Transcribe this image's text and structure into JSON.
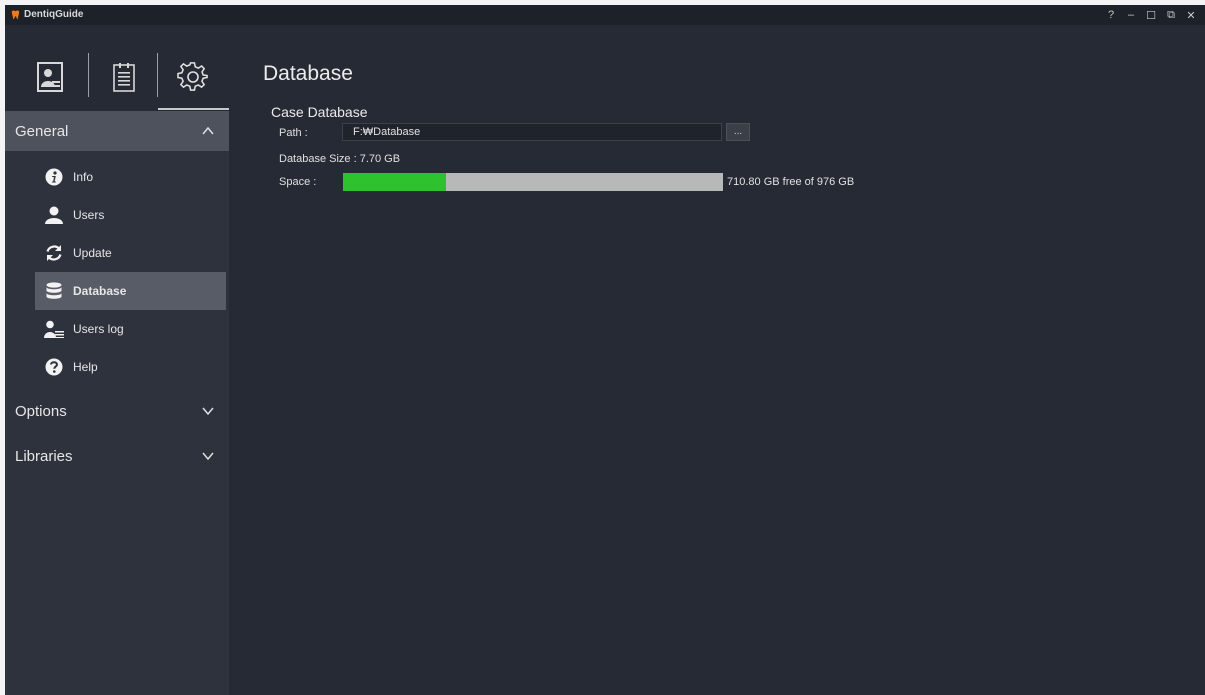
{
  "app": {
    "title": "DentiqGuide",
    "controls": [
      "?",
      "–",
      "☐",
      "⧉",
      "✕"
    ]
  },
  "sidebar": {
    "tabs": [
      {
        "name": "patient",
        "icon": "patient-card-icon"
      },
      {
        "name": "plan",
        "icon": "clipboard-list-icon"
      },
      {
        "name": "settings",
        "icon": "gear-icon",
        "active": true
      }
    ],
    "sections": [
      {
        "label": "General",
        "expanded": true
      },
      {
        "label": "Options",
        "expanded": false
      },
      {
        "label": "Libraries",
        "expanded": false
      }
    ],
    "items": [
      {
        "label": "Info",
        "icon": "info-icon"
      },
      {
        "label": "Users",
        "icon": "user-icon"
      },
      {
        "label": "Update",
        "icon": "refresh-icon"
      },
      {
        "label": "Database",
        "icon": "database-icon",
        "selected": true
      },
      {
        "label": "Users log",
        "icon": "user-log-icon"
      },
      {
        "label": "Help",
        "icon": "help-icon"
      }
    ]
  },
  "main": {
    "title": "Database",
    "section_title": "Case Database",
    "path_label": "Path :",
    "path_value": "F:₩Database",
    "browse_label": "...",
    "size_label": "Database Size : 7.70 GB",
    "space_label": "Space :",
    "space_used_fraction": 0.272,
    "space_text": "710.80 GB free of 976 GB"
  },
  "colors": {
    "background": "#252a34",
    "sidebar": "#2d323d",
    "progress_fill": "#2dc32d",
    "progress_track": "#b8b8b8"
  }
}
